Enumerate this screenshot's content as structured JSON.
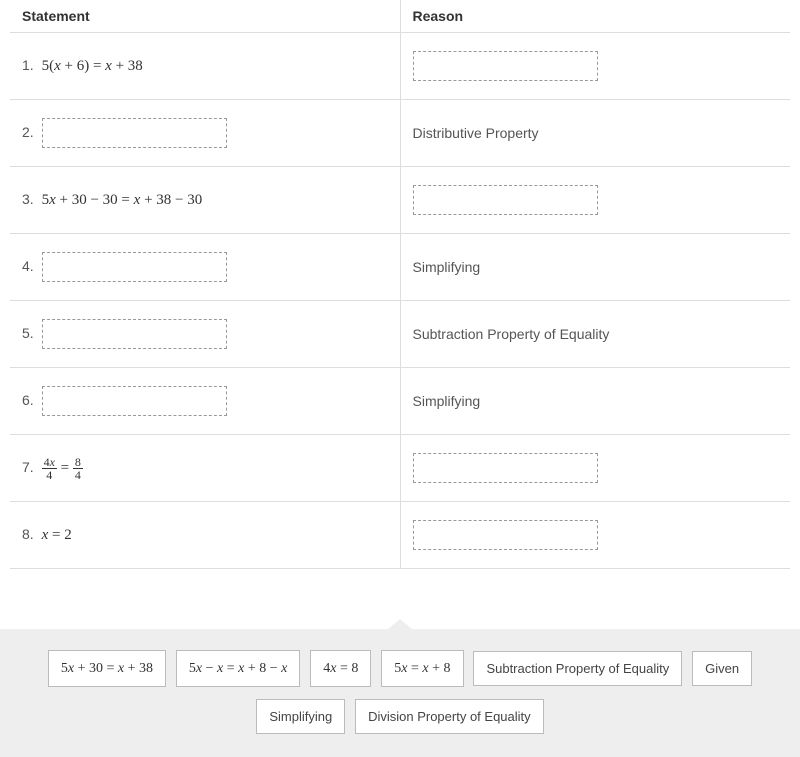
{
  "headers": {
    "statement": "Statement",
    "reason": "Reason"
  },
  "rows": [
    {
      "num": "1.",
      "stmt_type": "math",
      "stmt_math": "5(x + 6) = x + 38",
      "reason_type": "drop"
    },
    {
      "num": "2.",
      "stmt_type": "drop",
      "reason_type": "text",
      "reason_text": "Distributive Property"
    },
    {
      "num": "3.",
      "stmt_type": "math",
      "stmt_math": "5x + 30 − 30 = x + 38 − 30",
      "reason_type": "drop"
    },
    {
      "num": "4.",
      "stmt_type": "drop",
      "reason_type": "text",
      "reason_text": "Simplifying"
    },
    {
      "num": "5.",
      "stmt_type": "drop",
      "reason_type": "text",
      "reason_text": "Subtraction Property of Equality"
    },
    {
      "num": "6.",
      "stmt_type": "drop",
      "reason_type": "text",
      "reason_text": "Simplifying"
    },
    {
      "num": "7.",
      "stmt_type": "frac",
      "frac_left_num": "4x",
      "frac_left_den": "4",
      "frac_right_num": "8",
      "frac_right_den": "4",
      "reason_type": "drop"
    },
    {
      "num": "8.",
      "stmt_type": "math",
      "stmt_math": "x = 2",
      "reason_type": "drop"
    }
  ],
  "tiles": {
    "t1": "5x + 30 = x + 38",
    "t2": "5x − x = x + 8 − x",
    "t3": "4x = 8",
    "t4": "5x = x + 8",
    "t5": "Subtraction Property of Equality",
    "t6": "Given",
    "t7": "Simplifying",
    "t8": "Division Property of Equality"
  }
}
